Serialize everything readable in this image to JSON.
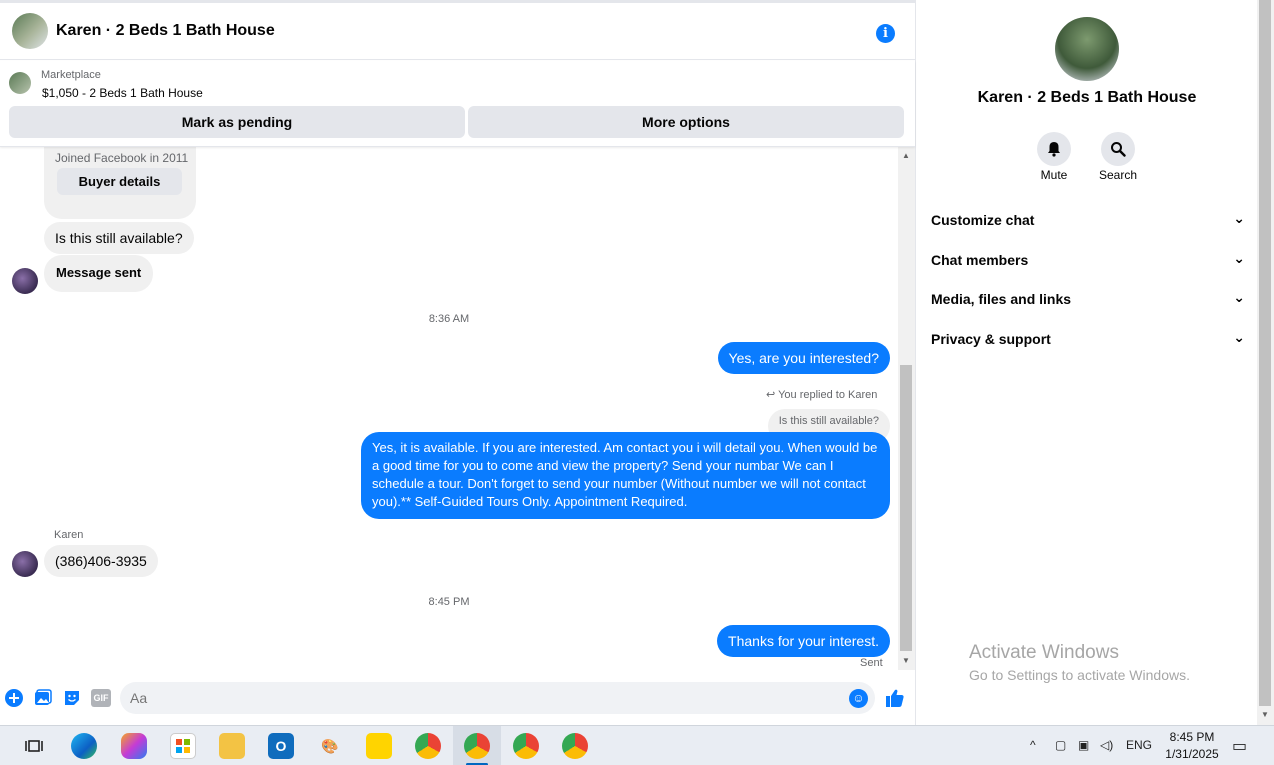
{
  "header": {
    "title": "Karen · 2 Beds 1 Bath House",
    "info_icon": "i"
  },
  "listing": {
    "category": "Marketplace",
    "title": "$1,050 - 2 Beds 1 Bath House",
    "pending_label": "Mark as pending",
    "more_label": "More options"
  },
  "messages": {
    "buyer_joined": "Joined Facebook in 2011",
    "buyer_details_label": "Buyer details",
    "m1": "Is this still available?",
    "m2": "Message sent",
    "time1": "8:36 AM",
    "m3": "Yes, are you interested?",
    "replied_to": "You replied to Karen",
    "quoted": "Is this still available?",
    "m4": "Yes, it is available. If you are interested.  Am contact you i will detail you.  When would be a good time for you to come and view the property? Send your numbar We can I schedule a tour.  Don't forget to send your number (Without number we will not contact you).** Self-Guided Tours Only. Appointment Required.",
    "sender_name": "Karen",
    "m5": "(386)406-3935",
    "time2": "8:45 PM",
    "m6": "Thanks for your interest.",
    "status": "Sent"
  },
  "composer": {
    "placeholder": "Aa",
    "gif_label": "GIF"
  },
  "info_panel": {
    "name": "Karen · 2 Beds 1 Bath House",
    "mute_label": "Mute",
    "search_label": "Search",
    "sections": [
      "Customize chat",
      "Chat members",
      "Media, files and links",
      "Privacy & support"
    ]
  },
  "watermark": {
    "title": "Activate Windows",
    "subtitle": "Go to Settings to activate Windows."
  },
  "taskbar": {
    "lang": "ENG",
    "time": "8:45 PM",
    "date": "1/31/2025"
  },
  "colors": {
    "accent": "#0a7cff",
    "bubble_gray": "#f0f0f0",
    "button_gray": "#e4e6eb"
  }
}
